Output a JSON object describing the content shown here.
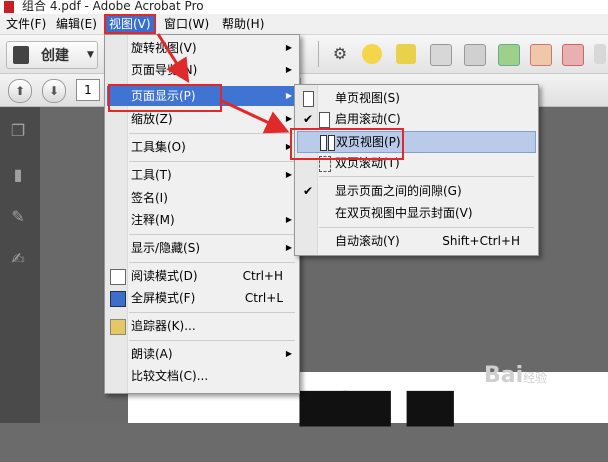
{
  "window": {
    "title": "组合 4.pdf - Adobe Acrobat Pro"
  },
  "menubar": {
    "items": [
      {
        "label": "文件(F)"
      },
      {
        "label": "编辑(E)"
      },
      {
        "label": "视图(V)"
      },
      {
        "label": "窗口(W)"
      },
      {
        "label": "帮助(H)"
      }
    ]
  },
  "toolbar": {
    "create_label": "创建"
  },
  "navigation": {
    "page_number": "1"
  },
  "view_menu": {
    "items": [
      {
        "label": "旋转视图(V)",
        "submenu": true
      },
      {
        "label": "页面导览(N)",
        "submenu": true
      },
      {
        "label": "页面显示(P)",
        "submenu": true
      },
      {
        "label": "缩放(Z)",
        "submenu": true
      },
      {
        "label": "工具集(O)",
        "submenu": true
      },
      {
        "label": "工具(T)",
        "submenu": true
      },
      {
        "label": "签名(I)"
      },
      {
        "label": "注释(M)",
        "submenu": true
      },
      {
        "label": "显示/隐藏(S)",
        "submenu": true
      },
      {
        "label": "阅读模式(D)",
        "shortcut": "Ctrl+H"
      },
      {
        "label": "全屏模式(F)",
        "shortcut": "Ctrl+L"
      },
      {
        "label": "追踪器(K)..."
      },
      {
        "label": "朗读(A)",
        "submenu": true
      },
      {
        "label": "比较文档(C)..."
      }
    ]
  },
  "page_display_submenu": {
    "items": [
      {
        "label": "单页视图(S)"
      },
      {
        "label": "启用滚动(C)",
        "checked": true
      },
      {
        "label": "双页视图(P)"
      },
      {
        "label": "双页滚动(T)"
      },
      {
        "label": "显示页面之间的间隙(G)",
        "checked": true
      },
      {
        "label": "在双页视图中显示封面(V)"
      },
      {
        "label": "自动滚动(Y)",
        "shortcut": "Shift+Ctrl+H"
      }
    ]
  },
  "colors": {
    "menu_highlight": "#3f74d3",
    "annotation_red": "#e02a2a",
    "selected_item": "#b9cbe8"
  },
  "watermark": {
    "brand": "Bai",
    "suffix": "经验"
  }
}
